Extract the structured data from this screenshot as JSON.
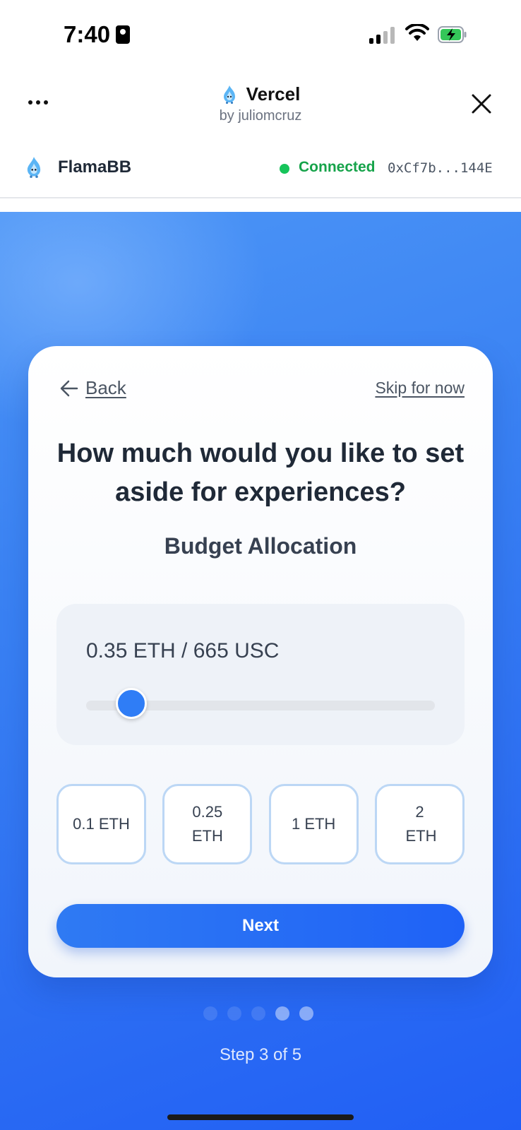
{
  "status_bar": {
    "time": "7:40"
  },
  "header": {
    "app_title": "Vercel",
    "app_subtitle": "by juliomcruz"
  },
  "account": {
    "name": "FlamaBB",
    "status": "Connected",
    "address": "0xCf7b...144E",
    "status_color": "#16a34a"
  },
  "card": {
    "back_label": "Back",
    "skip_label": "Skip for now",
    "question": "How much would you like to set aside for experiences?",
    "subtitle": "Budget Allocation",
    "amount_display": "0.35 ETH / 665 USC",
    "slider_fraction": 0.13,
    "presets": [
      {
        "label": "0.1 ETH"
      },
      {
        "label": "0.25 ETH"
      },
      {
        "label": "1 ETH"
      },
      {
        "label": "2 ETH"
      }
    ],
    "next_label": "Next"
  },
  "pagination": {
    "total_steps": 5,
    "current_step": 3,
    "step_text": "Step 3 of 5"
  },
  "colors": {
    "accent": "#2f7df6",
    "background_gradient_start": "#4c95f6",
    "background_gradient_end": "#215ff5"
  }
}
